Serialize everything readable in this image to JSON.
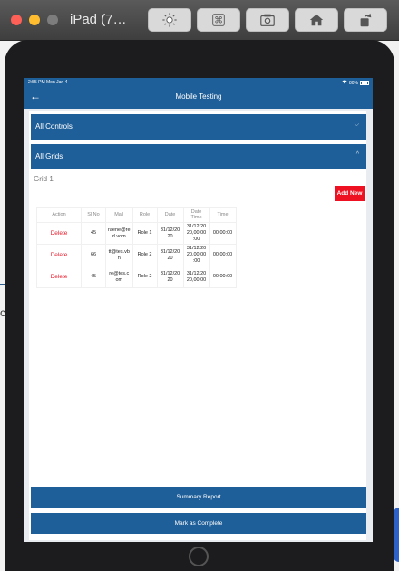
{
  "simulator": {
    "title": "iPad (7…",
    "buttons": [
      {
        "name": "brightness-icon"
      },
      {
        "name": "command-icon"
      },
      {
        "name": "screenshot-icon"
      },
      {
        "name": "home-icon"
      },
      {
        "name": "rotate-icon"
      }
    ]
  },
  "background": {
    "partial_char": "ct"
  },
  "status_bar": {
    "time": "2:55 PM  Mon Jan 4",
    "battery": "80%"
  },
  "navbar": {
    "title": "Mobile Testing",
    "back_icon": "arrow-left-icon"
  },
  "sections": {
    "all_controls": {
      "label": "All Controls",
      "chevron": "chevron-down-icon"
    },
    "all_grids": {
      "label": "All Grids",
      "chevron": "chevron-up-icon"
    }
  },
  "grid": {
    "label": "Grid 1",
    "add_new": "Add New",
    "columns": [
      "Action",
      "Sl No",
      "Mail",
      "Role",
      "Date",
      "Date Time",
      "Time"
    ],
    "rows": [
      {
        "action": "Delete",
        "sl_no": "45",
        "mail": "raene@re d.vom",
        "role": "Role 1",
        "date": "31/12/20 20",
        "date_time": "31/12/20 20,00:00 :00",
        "time": "00:00:00"
      },
      {
        "action": "Delete",
        "sl_no": "66",
        "mail": "tt@tes.vb n",
        "role": "Role 2",
        "date": "31/12/20 20",
        "date_time": "31/12/20 20,00:00 :00",
        "time": "00:00:00"
      },
      {
        "action": "Delete",
        "sl_no": "45",
        "mail": "re@tes.c om",
        "role": "Role 2",
        "date": "31/12/20 20",
        "date_time": "31/12/20 20,00:00",
        "time": "00:00:00"
      }
    ]
  },
  "footer": {
    "summary_report": "Summary Report",
    "mark_complete": "Mark as Complete"
  }
}
